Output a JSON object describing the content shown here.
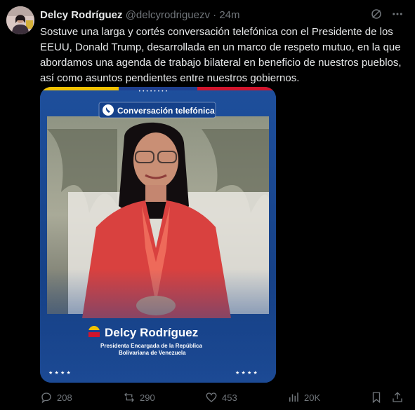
{
  "author": {
    "display_name": "Delcy Rodríguez",
    "handle": "@delcyrodriguezv",
    "separator": "·",
    "time": "24m"
  },
  "tweet": {
    "text": "Sostuve una larga y cortés conversación telefónica con el Presidente de los EEUU, Donald Trump, desarrollada en un marco de respeto mutuo, en la que abordamos una agenda de trabajo bilateral en beneficio de nuestros pueblos, así como asuntos pendientes entre nuestros gobiernos."
  },
  "media": {
    "badge": "Conversación telefónica",
    "name": "Delcy Rodríguez",
    "subtitle_line1": "Presidenta Encargada de la República",
    "subtitle_line2": "Bolivariana de Venezuela",
    "stars": "★ ★ ★ ★",
    "dots": "• • • • • • • •"
  },
  "actions": {
    "replies": "208",
    "reposts": "290",
    "likes": "453",
    "views": "20K"
  },
  "icons": [
    "grok-icon",
    "more-icon",
    "reply-icon",
    "repost-icon",
    "like-icon",
    "views-icon",
    "bookmark-icon",
    "share-icon",
    "phone-icon",
    "venezuela-flag-icon"
  ],
  "colors": {
    "background": "#000000",
    "text": "#e7e9ea",
    "muted": "#71767b",
    "media_blue": "#1d4f9a"
  }
}
